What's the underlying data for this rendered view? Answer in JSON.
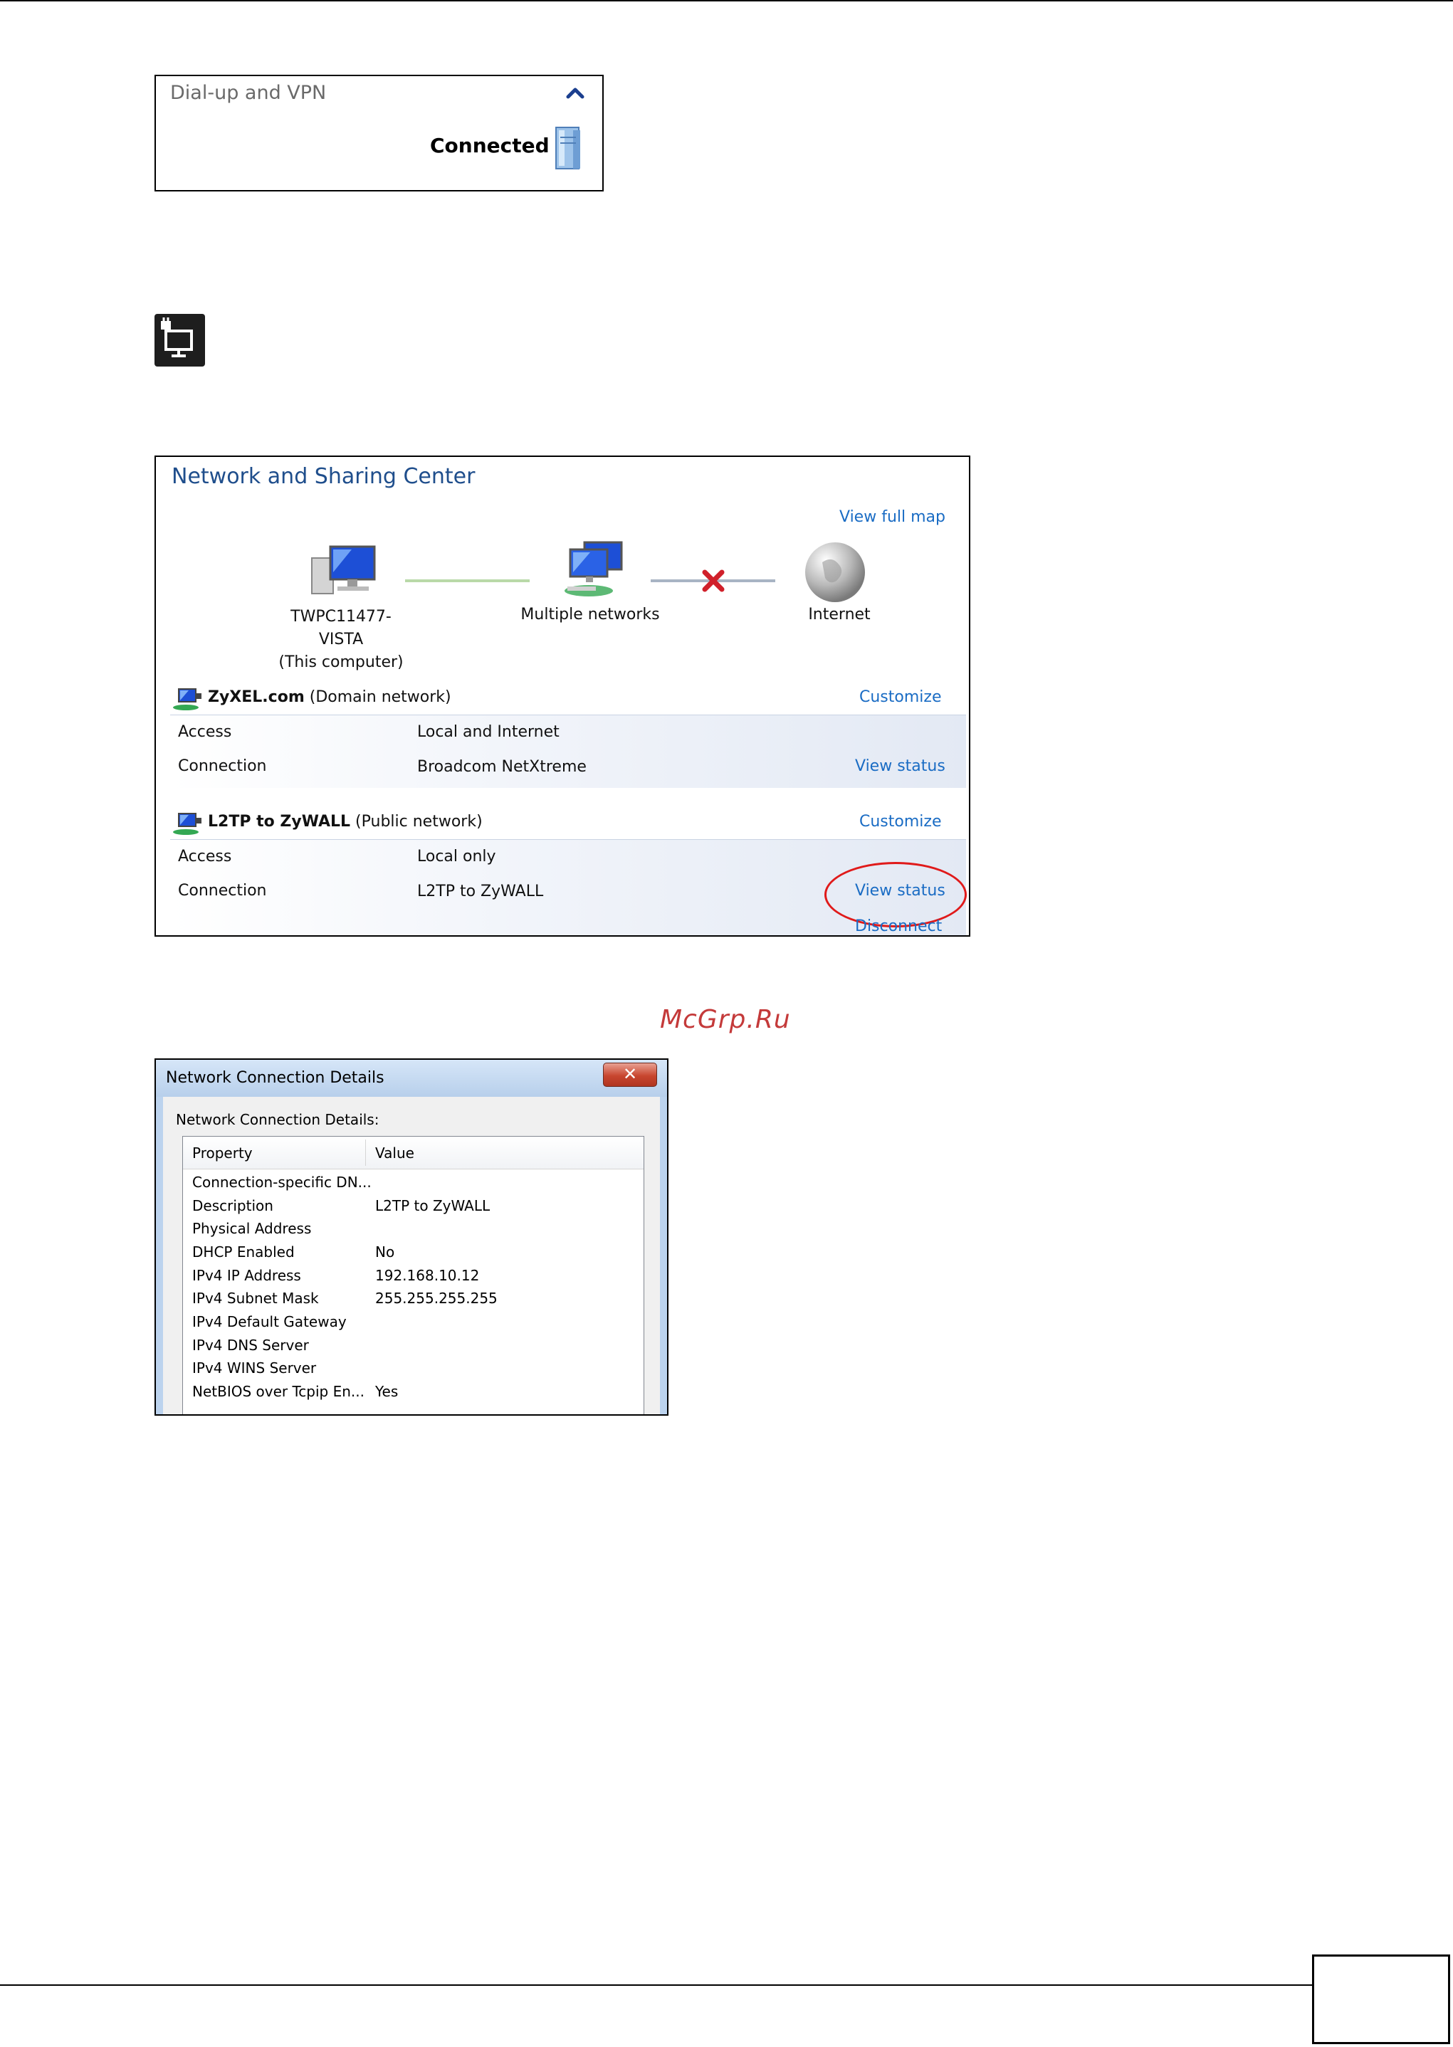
{
  "dialup": {
    "title": "Dial-up and VPN",
    "status": "Connected",
    "chevron": "chevron-up-icon"
  },
  "tray": {
    "icon": "network-tray-icon"
  },
  "nsc": {
    "title": "Network and Sharing Center",
    "view_full_map": "View full map",
    "nodes": {
      "computer": "TWPC11477-VISTA",
      "computer_sub": "(This computer)",
      "networks": "Multiple networks",
      "internet": "Internet"
    },
    "networks": [
      {
        "name": "ZyXEL.com",
        "type": "(Domain network)",
        "customize": "Customize",
        "access_label": "Access",
        "access_value": "Local and Internet",
        "connection_label": "Connection",
        "connection_value": "Broadcom NetXtreme",
        "view_status": "View status"
      },
      {
        "name": "L2TP to ZyWALL",
        "type": "(Public network)",
        "customize": "Customize",
        "access_label": "Access",
        "access_value": "Local only",
        "connection_label": "Connection",
        "connection_value": "L2TP to ZyWALL",
        "view_status": "View status",
        "disconnect": "Disconnect"
      }
    ],
    "colors": {
      "link": "#1a6cc4",
      "highlight": "#e01a1a"
    }
  },
  "watermark": "McGrp.Ru",
  "details": {
    "title": "Network Connection Details",
    "close": "✕",
    "label": "Network Connection Details:",
    "headers": {
      "property": "Property",
      "value": "Value"
    },
    "rows": [
      {
        "property": "Connection-specific DN...",
        "value": ""
      },
      {
        "property": "Description",
        "value": "L2TP to ZyWALL"
      },
      {
        "property": "Physical Address",
        "value": ""
      },
      {
        "property": "DHCP Enabled",
        "value": "No"
      },
      {
        "property": "IPv4 IP Address",
        "value": "192.168.10.12"
      },
      {
        "property": "IPv4 Subnet Mask",
        "value": "255.255.255.255"
      },
      {
        "property": "IPv4 Default Gateway",
        "value": ""
      },
      {
        "property": "IPv4 DNS Server",
        "value": ""
      },
      {
        "property": "IPv4 WINS Server",
        "value": ""
      },
      {
        "property": "NetBIOS over Tcpip En...",
        "value": "Yes"
      }
    ]
  }
}
